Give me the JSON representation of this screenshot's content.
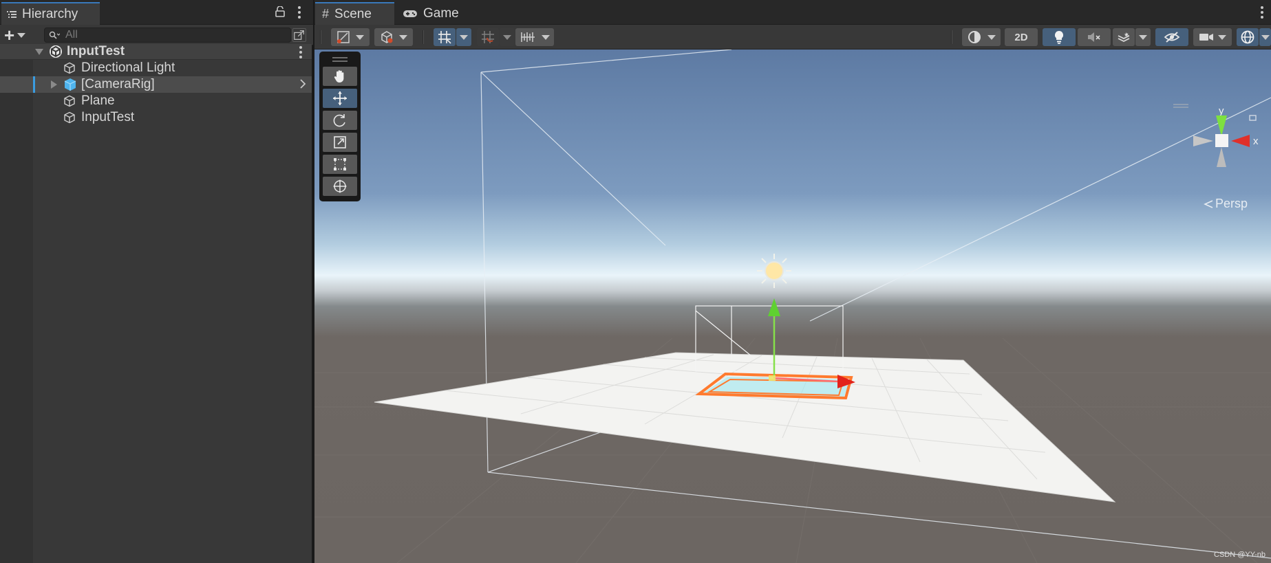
{
  "hierarchy": {
    "tab_label": "Hierarchy",
    "search_placeholder": "All",
    "items": [
      {
        "label": "InputTest"
      },
      {
        "label": "Directional Light"
      },
      {
        "label": "[CameraRig]"
      },
      {
        "label": "Plane"
      },
      {
        "label": "InputTest"
      }
    ]
  },
  "scene_view": {
    "tabs": [
      {
        "label": "Scene"
      },
      {
        "label": "Game"
      }
    ],
    "toolbar": {
      "mode_2d_label": "2D"
    },
    "tools": [
      {
        "icon": "hand-icon",
        "active": false
      },
      {
        "icon": "move-icon",
        "active": true
      },
      {
        "icon": "rotate-icon",
        "active": false
      },
      {
        "icon": "scale-icon",
        "active": false
      },
      {
        "icon": "rect-icon",
        "active": false
      },
      {
        "icon": "transform-icon",
        "active": false
      }
    ],
    "gizmo": {
      "y_label": "y",
      "x_label": "x",
      "projection_label": "Persp"
    },
    "watermark": "CSDN @YY-nb"
  },
  "colors": {
    "accent": "#3a79bb",
    "selection": "#3a9ce0",
    "active_tool": "#46607c",
    "sky_top": "#5d7aa3",
    "horizon": "#e9f4fa",
    "ground": "#6e6864",
    "outline": "#ff7a2e"
  }
}
